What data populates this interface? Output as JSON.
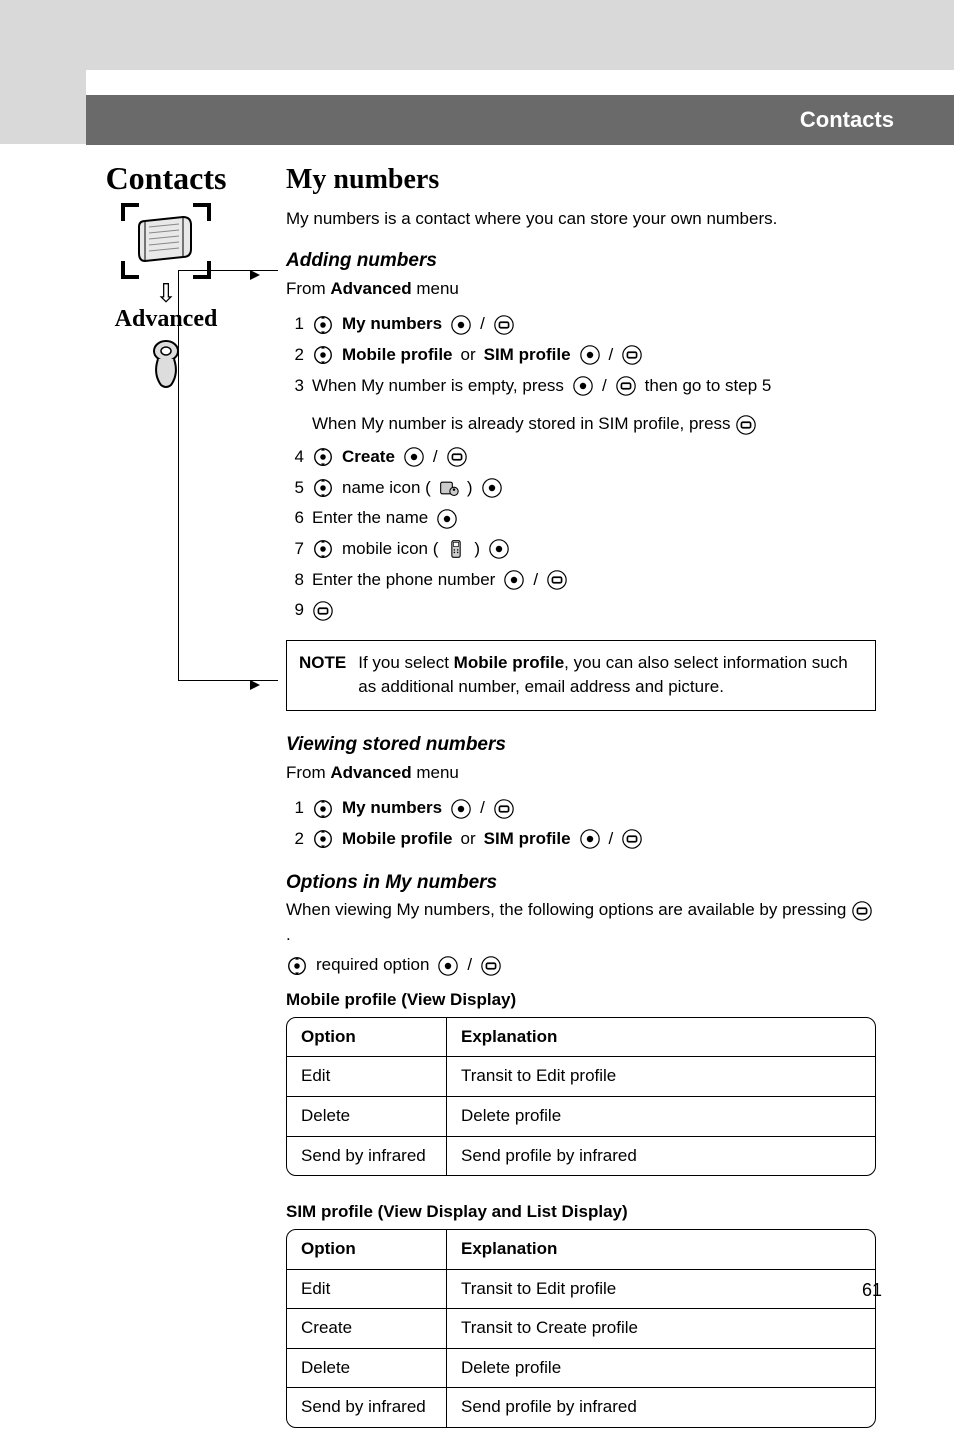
{
  "header": {
    "title": "Contacts"
  },
  "sidebar": {
    "title": "Contacts",
    "advanced_label": "Advanced"
  },
  "main": {
    "h1": "My numbers",
    "intro": "My numbers is a contact where you can store your own numbers.",
    "section1": {
      "h2": "Adding numbers",
      "from_prefix": "From ",
      "from_bold": "Advanced",
      "from_suffix": " menu",
      "steps": {
        "s1_bold": "My numbers",
        "s2_pre_bold": "Mobile profile",
        "s2_mid": " or ",
        "s2_post_bold": "SIM profile",
        "s3_a": "When My number is empty, press ",
        "s3_b": " then go to step 5",
        "s3_sub": "When My number is already stored in SIM profile, press ",
        "s4_bold": "Create",
        "s5_a": " name icon (",
        "s5_b": ") ",
        "s6": "Enter the name ",
        "s7_a": " mobile icon (",
        "s7_b": " ) ",
        "s8": "Enter the phone number "
      },
      "note_label": "NOTE",
      "note_text_a": "If you select ",
      "note_text_bold": "Mobile profile",
      "note_text_b": ", you can also select information such as additional number, email address and picture."
    },
    "section2": {
      "h2": "Viewing stored numbers",
      "from_prefix": "From ",
      "from_bold": "Advanced",
      "from_suffix": " menu",
      "steps": {
        "s1_bold": "My numbers",
        "s2_pre_bold": "Mobile profile",
        "s2_mid": " or ",
        "s2_post_bold": "SIM profile"
      }
    },
    "section3": {
      "h2": "Options in My numbers",
      "intro_a": "When viewing My numbers, the following options are available by pressing ",
      "intro_b": ".",
      "req_text": " required option ",
      "table1_caption": "Mobile profile (View Display)",
      "table1": {
        "h_option": "Option",
        "h_expl": "Explanation",
        "rows": [
          {
            "opt": "Edit",
            "expl": "Transit to Edit profile"
          },
          {
            "opt": "Delete",
            "expl": "Delete profile"
          },
          {
            "opt": "Send by infrared",
            "expl": "Send profile by infrared"
          }
        ]
      },
      "table2_caption": "SIM profile (View Display and List Display)",
      "table2": {
        "h_option": "Option",
        "h_expl": "Explanation",
        "rows": [
          {
            "opt": "Edit",
            "expl": "Transit to Edit profile"
          },
          {
            "opt": "Create",
            "expl": "Transit to Create profile"
          },
          {
            "opt": "Delete",
            "expl": "Delete profile"
          },
          {
            "opt": "Send by infrared",
            "expl": "Send profile by infrared"
          }
        ]
      }
    }
  },
  "page_number": "61"
}
